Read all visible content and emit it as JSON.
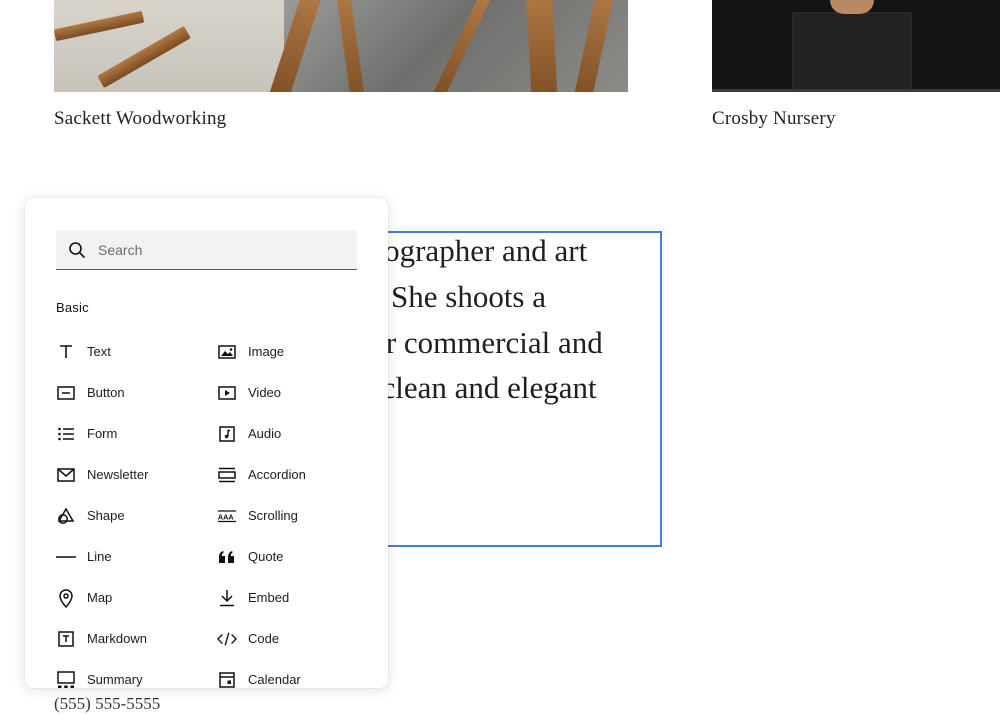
{
  "gallery": {
    "left_caption": "Sackett Woodworking",
    "right_caption": "Crosby Nursery"
  },
  "bio": {
    "lines": [
      "otographer and art",
      "n. She shoots a",
      " for commercial and",
      "a clean and elegant"
    ]
  },
  "contact": {
    "phone": "(555) 555-5555"
  },
  "block_picker": {
    "search_placeholder": "Search",
    "section_label": "Basic",
    "items": [
      {
        "label": "Text",
        "icon": "text-icon"
      },
      {
        "label": "Image",
        "icon": "image-icon"
      },
      {
        "label": "Button",
        "icon": "button-icon"
      },
      {
        "label": "Video",
        "icon": "video-icon"
      },
      {
        "label": "Form",
        "icon": "form-icon"
      },
      {
        "label": "Audio",
        "icon": "audio-icon"
      },
      {
        "label": "Newsletter",
        "icon": "newsletter-icon"
      },
      {
        "label": "Accordion",
        "icon": "accordion-icon"
      },
      {
        "label": "Shape",
        "icon": "shape-icon"
      },
      {
        "label": "Scrolling",
        "icon": "scrolling-icon"
      },
      {
        "label": "Line",
        "icon": "line-icon"
      },
      {
        "label": "Quote",
        "icon": "quote-icon"
      },
      {
        "label": "Map",
        "icon": "map-icon"
      },
      {
        "label": "Embed",
        "icon": "embed-icon"
      },
      {
        "label": "Markdown",
        "icon": "markdown-icon"
      },
      {
        "label": "Code",
        "icon": "code-icon"
      },
      {
        "label": "Summary",
        "icon": "summary-icon"
      },
      {
        "label": "Calendar",
        "icon": "calendar-icon"
      }
    ]
  },
  "colors": {
    "selection_border": "#3f7fe0",
    "panel_bg": "#ffffff",
    "search_bg": "#f2f2f2"
  }
}
